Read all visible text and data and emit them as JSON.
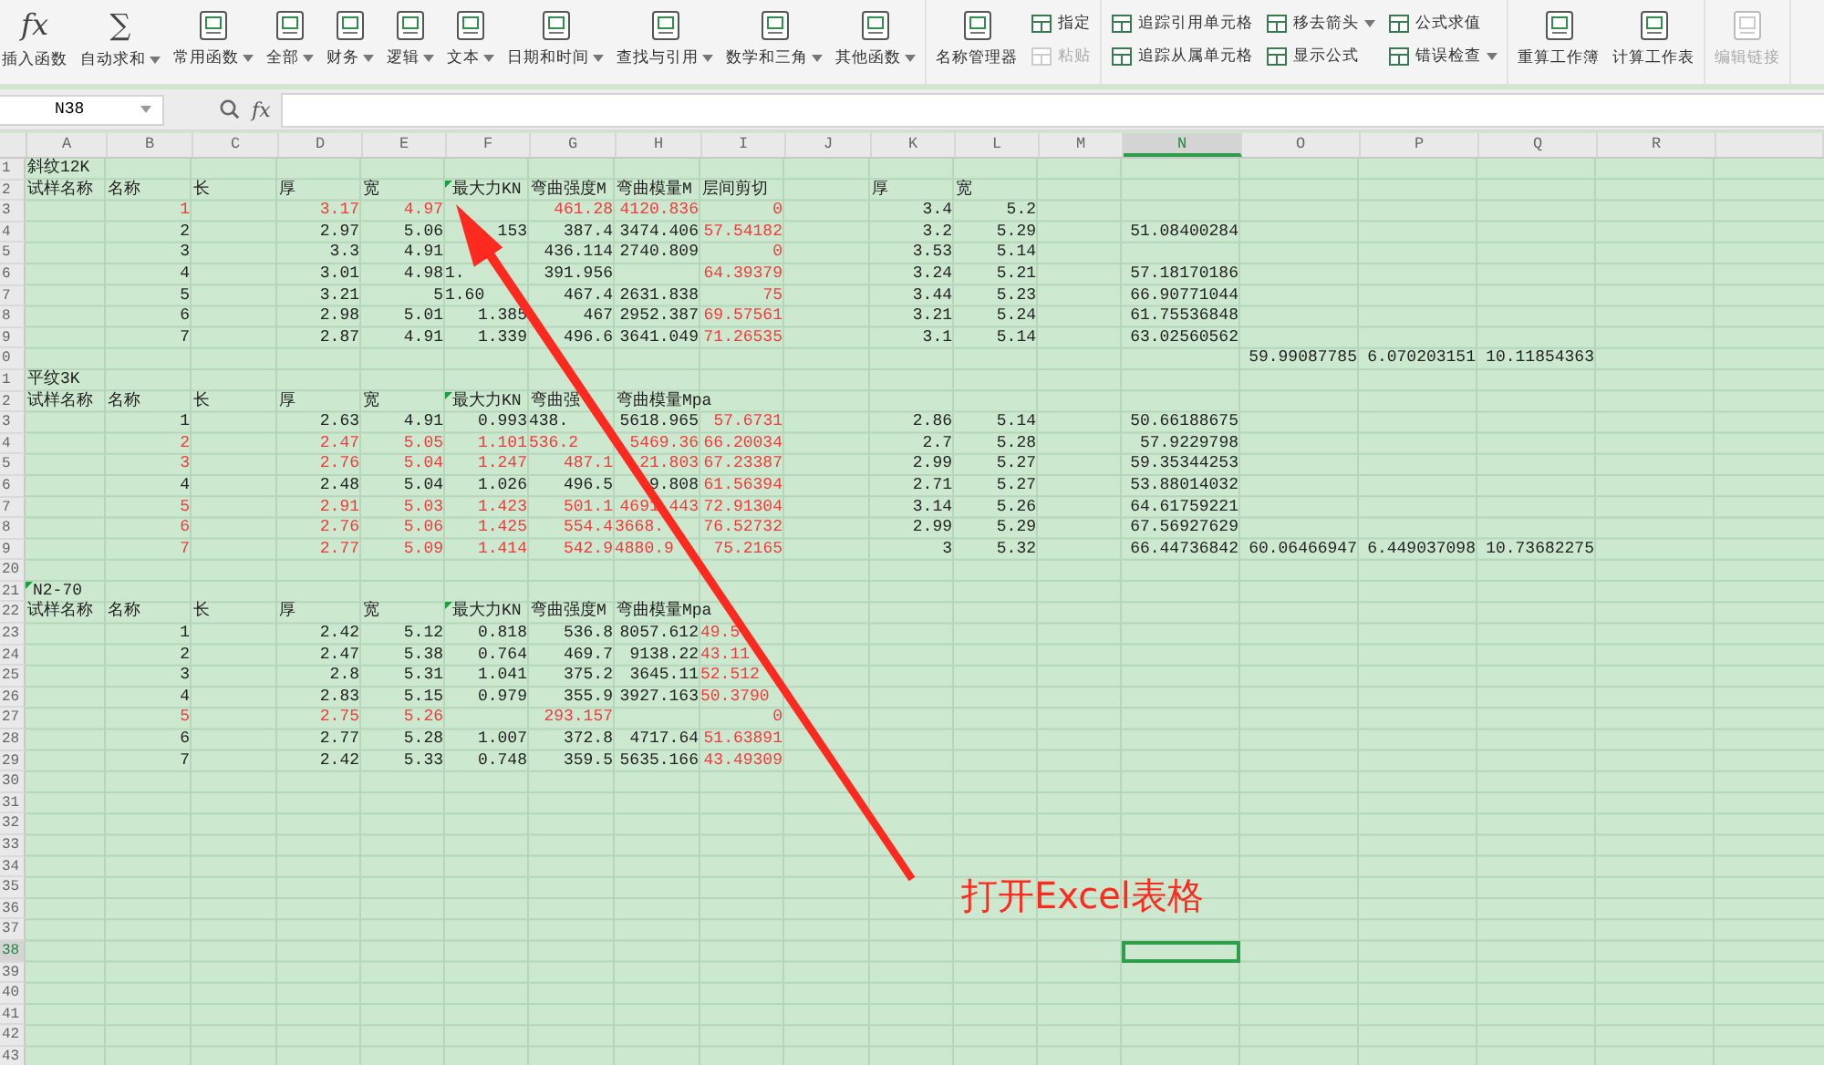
{
  "ribbon": [
    {
      "items": [
        {
          "kind": "large",
          "label": "插入函数",
          "glyph": "fx",
          "dropdown": false,
          "disabled": false
        },
        {
          "kind": "large",
          "label": "自动求和",
          "glyph": "∑",
          "dropdown": true,
          "disabled": false
        },
        {
          "kind": "large",
          "label": "常用函数",
          "dropdown": true,
          "disabled": false
        },
        {
          "kind": "large",
          "label": "全部",
          "dropdown": true,
          "disabled": false
        },
        {
          "kind": "large",
          "label": "财务",
          "dropdown": true,
          "disabled": false
        },
        {
          "kind": "large",
          "label": "逻辑",
          "dropdown": true,
          "disabled": false
        },
        {
          "kind": "large",
          "label": "文本",
          "dropdown": true,
          "disabled": false
        },
        {
          "kind": "large",
          "label": "日期和时间",
          "dropdown": true,
          "disabled": false
        },
        {
          "kind": "large",
          "label": "查找与引用",
          "dropdown": true,
          "disabled": false
        },
        {
          "kind": "large",
          "label": "数学和三角",
          "dropdown": true,
          "disabled": false
        },
        {
          "kind": "large",
          "label": "其他函数",
          "dropdown": true,
          "disabled": false
        }
      ]
    },
    {
      "items": [
        {
          "kind": "large",
          "label": "名称管理器",
          "dropdown": false,
          "disabled": false
        },
        {
          "kind": "stack",
          "items": [
            {
              "label": "指定",
              "dropdown": false,
              "disabled": false
            },
            {
              "label": "粘贴",
              "dropdown": false,
              "disabled": true
            }
          ]
        }
      ]
    },
    {
      "items": [
        {
          "kind": "stack",
          "items": [
            {
              "label": "追踪引用单元格",
              "dropdown": false,
              "disabled": false
            },
            {
              "label": "追踪从属单元格",
              "dropdown": false,
              "disabled": false
            }
          ]
        },
        {
          "kind": "stack",
          "items": [
            {
              "label": "移去箭头",
              "dropdown": true,
              "disabled": false
            },
            {
              "label": "显示公式",
              "dropdown": false,
              "disabled": false
            }
          ]
        },
        {
          "kind": "stack",
          "items": [
            {
              "label": "公式求值",
              "dropdown": false,
              "disabled": false
            },
            {
              "label": "错误检查",
              "dropdown": true,
              "disabled": false
            }
          ]
        }
      ]
    },
    {
      "items": [
        {
          "kind": "large",
          "label": "重算工作簿",
          "dropdown": false,
          "disabled": false
        },
        {
          "kind": "large",
          "label": "计算工作表",
          "dropdown": false,
          "disabled": false
        }
      ]
    },
    {
      "items": [
        {
          "kind": "large",
          "label": "编辑链接",
          "dropdown": false,
          "disabled": true
        }
      ]
    }
  ],
  "formula_bar": {
    "name_box": "N38",
    "glyph": "fx"
  },
  "columns": [
    {
      "label": "A",
      "selected": false
    },
    {
      "label": "B",
      "selected": false
    },
    {
      "label": "C",
      "selected": false
    },
    {
      "label": "D",
      "selected": false
    },
    {
      "label": "E",
      "selected": false
    },
    {
      "label": "F",
      "selected": false
    },
    {
      "label": "G",
      "selected": false
    },
    {
      "label": "H",
      "selected": false
    },
    {
      "label": "I",
      "selected": false
    },
    {
      "label": "J",
      "selected": false
    },
    {
      "label": "K",
      "selected": false
    },
    {
      "label": "L",
      "selected": false
    },
    {
      "label": "M",
      "selected": false
    },
    {
      "label": "N",
      "selected": true
    },
    {
      "label": "O",
      "selected": false
    },
    {
      "label": "P",
      "selected": false
    },
    {
      "label": "Q",
      "selected": false
    },
    {
      "label": "R",
      "selected": false
    }
  ],
  "rows": [
    {
      "num": "1",
      "selected": false,
      "cells": {
        "A": {
          "text": "斜纹12K",
          "kind": "text",
          "flagged": false,
          "note": false
        }
      }
    },
    {
      "num": "2",
      "selected": false,
      "cells": {
        "A": {
          "text": "试样名称",
          "kind": "text",
          "flagged": false,
          "note": false
        },
        "B": {
          "text": "名称",
          "kind": "text",
          "flagged": false,
          "note": false
        },
        "C": {
          "text": "长",
          "kind": "text",
          "flagged": false,
          "note": false
        },
        "D": {
          "text": "厚",
          "kind": "text",
          "flagged": false,
          "note": false
        },
        "E": {
          "text": "宽",
          "kind": "text",
          "flagged": false,
          "note": false
        },
        "F": {
          "text": "最大力KN",
          "kind": "text",
          "flagged": false,
          "note": true
        },
        "G": {
          "text": "弯曲强度M",
          "kind": "text",
          "flagged": false,
          "note": false
        },
        "H": {
          "text": "弯曲模量M",
          "kind": "text",
          "flagged": false,
          "note": false
        },
        "I": {
          "text": "层间剪切",
          "kind": "text",
          "flagged": false,
          "note": false
        },
        "K": {
          "text": "厚",
          "kind": "text",
          "flagged": false,
          "note": false
        },
        "L": {
          "text": "宽",
          "kind": "text",
          "flagged": false,
          "note": false
        }
      }
    },
    {
      "num": "3",
      "selected": false,
      "cells": {
        "B": {
          "text": "1",
          "kind": "number",
          "flagged": true,
          "note": false
        },
        "D": {
          "text": "3.17",
          "kind": "number",
          "flagged": true,
          "note": false
        },
        "E": {
          "text": "4.97",
          "kind": "number",
          "flagged": true,
          "note": false
        },
        "G": {
          "text": "461.28",
          "kind": "number",
          "flagged": true,
          "note": false
        },
        "H": {
          "text": "4120.836",
          "kind": "number",
          "flagged": true,
          "note": false
        },
        "I": {
          "text": "0",
          "kind": "number",
          "flagged": true,
          "note": false
        },
        "K": {
          "text": "3.4",
          "kind": "number",
          "flagged": false,
          "note": false
        },
        "L": {
          "text": "5.2",
          "kind": "number",
          "flagged": false,
          "note": false
        }
      }
    },
    {
      "num": "4",
      "selected": false,
      "cells": {
        "B": {
          "text": "2",
          "kind": "number",
          "flagged": false,
          "note": false
        },
        "D": {
          "text": "2.97",
          "kind": "number",
          "flagged": false,
          "note": false
        },
        "E": {
          "text": "5.06",
          "kind": "number",
          "flagged": false,
          "note": false
        },
        "F": {
          "text": "153",
          "kind": "number",
          "flagged": false,
          "note": false
        },
        "G": {
          "text": "387.4",
          "kind": "number",
          "flagged": false,
          "note": false
        },
        "H": {
          "text": "3474.406",
          "kind": "number",
          "flagged": false,
          "note": false
        },
        "I": {
          "text": "57.54182",
          "kind": "number",
          "flagged": true,
          "note": false
        },
        "K": {
          "text": "3.2",
          "kind": "number",
          "flagged": false,
          "note": false
        },
        "L": {
          "text": "5.29",
          "kind": "number",
          "flagged": false,
          "note": false
        },
        "N": {
          "text": "51.08400284",
          "kind": "number",
          "flagged": false,
          "note": false
        }
      }
    },
    {
      "num": "5",
      "selected": false,
      "cells": {
        "B": {
          "text": "3",
          "kind": "number",
          "flagged": false,
          "note": false
        },
        "D": {
          "text": "3.3",
          "kind": "number",
          "flagged": false,
          "note": false
        },
        "E": {
          "text": "4.91",
          "kind": "number",
          "flagged": false,
          "note": false
        },
        "G": {
          "text": "436.114",
          "kind": "number",
          "flagged": false,
          "note": false
        },
        "H": {
          "text": "2740.809",
          "kind": "number",
          "flagged": false,
          "note": false
        },
        "I": {
          "text": "0",
          "kind": "number",
          "flagged": true,
          "note": false
        },
        "K": {
          "text": "3.53",
          "kind": "number",
          "flagged": false,
          "note": false
        },
        "L": {
          "text": "5.14",
          "kind": "number",
          "flagged": false,
          "note": false
        }
      }
    },
    {
      "num": "6",
      "selected": false,
      "cells": {
        "B": {
          "text": "4",
          "kind": "number",
          "flagged": false,
          "note": false
        },
        "D": {
          "text": "3.01",
          "kind": "number",
          "flagged": false,
          "note": false
        },
        "E": {
          "text": "4.98",
          "kind": "number",
          "flagged": false,
          "note": false
        },
        "F": {
          "text": "1.",
          "kind": "partial",
          "flagged": false,
          "note": false
        },
        "G": {
          "text": "391.956",
          "kind": "number",
          "flagged": false,
          "note": false
        },
        "I": {
          "text": "64.39379",
          "kind": "number",
          "flagged": true,
          "note": false
        },
        "K": {
          "text": "3.24",
          "kind": "number",
          "flagged": false,
          "note": false
        },
        "L": {
          "text": "5.21",
          "kind": "number",
          "flagged": false,
          "note": false
        },
        "N": {
          "text": "57.18170186",
          "kind": "number",
          "flagged": false,
          "note": false
        }
      }
    },
    {
      "num": "7",
      "selected": false,
      "cells": {
        "B": {
          "text": "5",
          "kind": "number",
          "flagged": false,
          "note": false
        },
        "D": {
          "text": "3.21",
          "kind": "number",
          "flagged": false,
          "note": false
        },
        "E": {
          "text": "5",
          "kind": "number",
          "flagged": false,
          "note": false
        },
        "F": {
          "text": "1.60",
          "kind": "partial",
          "flagged": false,
          "note": false
        },
        "G": {
          "text": "467.4",
          "kind": "number",
          "flagged": false,
          "note": false
        },
        "H": {
          "text": "2631.838",
          "kind": "number",
          "flagged": false,
          "note": false
        },
        "I": {
          "text": "75",
          "kind": "number",
          "flagged": true,
          "note": false
        },
        "K": {
          "text": "3.44",
          "kind": "number",
          "flagged": false,
          "note": false
        },
        "L": {
          "text": "5.23",
          "kind": "number",
          "flagged": false,
          "note": false
        },
        "N": {
          "text": "66.90771044",
          "kind": "number",
          "flagged": false,
          "note": false
        }
      }
    },
    {
      "num": "8",
      "selected": false,
      "cells": {
        "B": {
          "text": "6",
          "kind": "number",
          "flagged": false,
          "note": false
        },
        "D": {
          "text": "2.98",
          "kind": "number",
          "flagged": false,
          "note": false
        },
        "E": {
          "text": "5.01",
          "kind": "number",
          "flagged": false,
          "note": false
        },
        "F": {
          "text": "1.385",
          "kind": "number",
          "flagged": false,
          "note": false
        },
        "G": {
          "text": "467",
          "kind": "number",
          "flagged": false,
          "note": false
        },
        "H": {
          "text": "2952.387",
          "kind": "number",
          "flagged": false,
          "note": false
        },
        "I": {
          "text": "69.57561",
          "kind": "number",
          "flagged": true,
          "note": false
        },
        "K": {
          "text": "3.21",
          "kind": "number",
          "flagged": false,
          "note": false
        },
        "L": {
          "text": "5.24",
          "kind": "number",
          "flagged": false,
          "note": false
        },
        "N": {
          "text": "61.75536848",
          "kind": "number",
          "flagged": false,
          "note": false
        }
      }
    },
    {
      "num": "9",
      "selected": false,
      "cells": {
        "B": {
          "text": "7",
          "kind": "number",
          "flagged": false,
          "note": false
        },
        "D": {
          "text": "2.87",
          "kind": "number",
          "flagged": false,
          "note": false
        },
        "E": {
          "text": "4.91",
          "kind": "number",
          "flagged": false,
          "note": false
        },
        "F": {
          "text": "1.339",
          "kind": "number",
          "flagged": false,
          "note": false
        },
        "G": {
          "text": "496.6",
          "kind": "number",
          "flagged": false,
          "note": false
        },
        "H": {
          "text": "3641.049",
          "kind": "number",
          "flagged": false,
          "note": false
        },
        "I": {
          "text": "71.26535",
          "kind": "number",
          "flagged": true,
          "note": false
        },
        "K": {
          "text": "3.1",
          "kind": "number",
          "flagged": false,
          "note": false
        },
        "L": {
          "text": "5.14",
          "kind": "number",
          "flagged": false,
          "note": false
        },
        "N": {
          "text": "63.02560562",
          "kind": "number",
          "flagged": false,
          "note": false
        }
      }
    },
    {
      "num": "0",
      "selected": false,
      "cells": {
        "O": {
          "text": "59.99087785",
          "kind": "number",
          "flagged": false,
          "note": false
        },
        "P": {
          "text": "6.070203151",
          "kind": "number",
          "flagged": false,
          "note": false
        },
        "Q": {
          "text": "10.11854363",
          "kind": "number",
          "flagged": false,
          "note": false
        }
      }
    },
    {
      "num": "1",
      "selected": false,
      "cells": {
        "A": {
          "text": "平纹3K",
          "kind": "text",
          "flagged": false,
          "note": false
        }
      }
    },
    {
      "num": "2",
      "selected": false,
      "cells": {
        "A": {
          "text": "试样名称",
          "kind": "text",
          "flagged": false,
          "note": false
        },
        "B": {
          "text": "名称",
          "kind": "text",
          "flagged": false,
          "note": false
        },
        "C": {
          "text": "长",
          "kind": "text",
          "flagged": false,
          "note": false
        },
        "D": {
          "text": "厚",
          "kind": "text",
          "flagged": false,
          "note": false
        },
        "E": {
          "text": "宽",
          "kind": "text",
          "flagged": false,
          "note": false
        },
        "F": {
          "text": "最大力KN",
          "kind": "text",
          "flagged": false,
          "note": true
        },
        "G": {
          "text": "弯曲强",
          "kind": "text",
          "flagged": false,
          "note": false
        },
        "H": {
          "text": "弯曲模量Mpa",
          "kind": "text",
          "flagged": false,
          "note": false
        }
      }
    },
    {
      "num": "3",
      "selected": false,
      "cells": {
        "B": {
          "text": "1",
          "kind": "number",
          "flagged": false,
          "note": false
        },
        "D": {
          "text": "2.63",
          "kind": "number",
          "flagged": false,
          "note": false
        },
        "E": {
          "text": "4.91",
          "kind": "number",
          "flagged": false,
          "note": false
        },
        "F": {
          "text": "0.993",
          "kind": "number",
          "flagged": false,
          "note": false
        },
        "G": {
          "text": "438.",
          "kind": "partial",
          "flagged": false,
          "note": false
        },
        "H": {
          "text": "5618.965",
          "kind": "number",
          "flagged": false,
          "note": false
        },
        "I": {
          "text": "57.6731",
          "kind": "number",
          "flagged": true,
          "note": false
        },
        "K": {
          "text": "2.86",
          "kind": "number",
          "flagged": false,
          "note": false
        },
        "L": {
          "text": "5.14",
          "kind": "number",
          "flagged": false,
          "note": false
        },
        "N": {
          "text": "50.66188675",
          "kind": "number",
          "flagged": false,
          "note": false
        }
      }
    },
    {
      "num": "4",
      "selected": false,
      "cells": {
        "B": {
          "text": "2",
          "kind": "number",
          "flagged": true,
          "note": false
        },
        "D": {
          "text": "2.47",
          "kind": "number",
          "flagged": true,
          "note": false
        },
        "E": {
          "text": "5.05",
          "kind": "number",
          "flagged": true,
          "note": false
        },
        "F": {
          "text": "1.101",
          "kind": "number",
          "flagged": true,
          "note": false
        },
        "G": {
          "text": "536.2",
          "kind": "partial",
          "flagged": true,
          "note": false
        },
        "H": {
          "text": "5469.36",
          "kind": "number",
          "flagged": true,
          "note": false
        },
        "I": {
          "text": "66.20034",
          "kind": "number",
          "flagged": true,
          "note": false
        },
        "K": {
          "text": "2.7",
          "kind": "number",
          "flagged": false,
          "note": false
        },
        "L": {
          "text": "5.28",
          "kind": "number",
          "flagged": false,
          "note": false
        },
        "N": {
          "text": "57.9229798",
          "kind": "number",
          "flagged": false,
          "note": false
        }
      }
    },
    {
      "num": "5",
      "selected": false,
      "cells": {
        "B": {
          "text": "3",
          "kind": "number",
          "flagged": true,
          "note": false
        },
        "D": {
          "text": "2.76",
          "kind": "number",
          "flagged": true,
          "note": false
        },
        "E": {
          "text": "5.04",
          "kind": "number",
          "flagged": true,
          "note": false
        },
        "F": {
          "text": "1.247",
          "kind": "number",
          "flagged": true,
          "note": false
        },
        "G": {
          "text": "487.1",
          "kind": "number",
          "flagged": true,
          "note": false
        },
        "H": {
          "text": "21.803",
          "kind": "number",
          "flagged": true,
          "note": false
        },
        "I": {
          "text": "67.23387",
          "kind": "number",
          "flagged": true,
          "note": false
        },
        "K": {
          "text": "2.99",
          "kind": "number",
          "flagged": false,
          "note": false
        },
        "L": {
          "text": "5.27",
          "kind": "number",
          "flagged": false,
          "note": false
        },
        "N": {
          "text": "59.35344253",
          "kind": "number",
          "flagged": false,
          "note": false
        }
      }
    },
    {
      "num": "6",
      "selected": false,
      "cells": {
        "B": {
          "text": "4",
          "kind": "number",
          "flagged": false,
          "note": false
        },
        "D": {
          "text": "2.48",
          "kind": "number",
          "flagged": false,
          "note": false
        },
        "E": {
          "text": "5.04",
          "kind": "number",
          "flagged": false,
          "note": false
        },
        "F": {
          "text": "1.026",
          "kind": "number",
          "flagged": false,
          "note": false
        },
        "G": {
          "text": "496.5",
          "kind": "number",
          "flagged": false,
          "note": false
        },
        "H": {
          "text": "9.808",
          "kind": "number",
          "flagged": false,
          "note": false
        },
        "I": {
          "text": "61.56394",
          "kind": "number",
          "flagged": true,
          "note": false
        },
        "K": {
          "text": "2.71",
          "kind": "number",
          "flagged": false,
          "note": false
        },
        "L": {
          "text": "5.27",
          "kind": "number",
          "flagged": false,
          "note": false
        },
        "N": {
          "text": "53.88014032",
          "kind": "number",
          "flagged": false,
          "note": false
        }
      }
    },
    {
      "num": "7",
      "selected": false,
      "cells": {
        "B": {
          "text": "5",
          "kind": "number",
          "flagged": true,
          "note": false
        },
        "D": {
          "text": "2.91",
          "kind": "number",
          "flagged": true,
          "note": false
        },
        "E": {
          "text": "5.03",
          "kind": "number",
          "flagged": true,
          "note": false
        },
        "F": {
          "text": "1.423",
          "kind": "number",
          "flagged": true,
          "note": false
        },
        "G": {
          "text": "501.1",
          "kind": "number",
          "flagged": true,
          "note": false
        },
        "H": {
          "text": "4691 443",
          "kind": "number",
          "flagged": true,
          "note": false
        },
        "I": {
          "text": "72.91304",
          "kind": "number",
          "flagged": true,
          "note": false
        },
        "K": {
          "text": "3.14",
          "kind": "number",
          "flagged": false,
          "note": false
        },
        "L": {
          "text": "5.26",
          "kind": "number",
          "flagged": false,
          "note": false
        },
        "N": {
          "text": "64.61759221",
          "kind": "number",
          "flagged": false,
          "note": false
        }
      }
    },
    {
      "num": "8",
      "selected": false,
      "cells": {
        "B": {
          "text": "6",
          "kind": "number",
          "flagged": true,
          "note": false
        },
        "D": {
          "text": "2.76",
          "kind": "number",
          "flagged": true,
          "note": false
        },
        "E": {
          "text": "5.06",
          "kind": "number",
          "flagged": true,
          "note": false
        },
        "F": {
          "text": "1.425",
          "kind": "number",
          "flagged": true,
          "note": false
        },
        "G": {
          "text": "554.4",
          "kind": "number",
          "flagged": true,
          "note": false
        },
        "H": {
          "text": "3668.",
          "kind": "partial",
          "flagged": true,
          "note": false
        },
        "I": {
          "text": "76.52732",
          "kind": "number",
          "flagged": true,
          "note": false
        },
        "K": {
          "text": "2.99",
          "kind": "number",
          "flagged": false,
          "note": false
        },
        "L": {
          "text": "5.29",
          "kind": "number",
          "flagged": false,
          "note": false
        },
        "N": {
          "text": "67.56927629",
          "kind": "number",
          "flagged": false,
          "note": false
        }
      }
    },
    {
      "num": "9",
      "selected": false,
      "cells": {
        "B": {
          "text": "7",
          "kind": "number",
          "flagged": true,
          "note": false
        },
        "D": {
          "text": "2.77",
          "kind": "number",
          "flagged": true,
          "note": false
        },
        "E": {
          "text": "5.09",
          "kind": "number",
          "flagged": true,
          "note": false
        },
        "F": {
          "text": "1.414",
          "kind": "number",
          "flagged": true,
          "note": false
        },
        "G": {
          "text": "542.9",
          "kind": "number",
          "flagged": true,
          "note": false
        },
        "H": {
          "text": "4880.9",
          "kind": "partial",
          "flagged": true,
          "note": false
        },
        "I": {
          "text": "75.2165",
          "kind": "number",
          "flagged": true,
          "note": false
        },
        "K": {
          "text": "3",
          "kind": "number",
          "flagged": false,
          "note": false
        },
        "L": {
          "text": "5.32",
          "kind": "number",
          "flagged": false,
          "note": false
        },
        "N": {
          "text": "66.44736842",
          "kind": "number",
          "flagged": false,
          "note": false
        },
        "O": {
          "text": "60.06466947",
          "kind": "number",
          "flagged": false,
          "note": false
        },
        "P": {
          "text": "6.449037098",
          "kind": "number",
          "flagged": false,
          "note": false
        },
        "Q": {
          "text": "10.73682275",
          "kind": "number",
          "flagged": false,
          "note": false
        }
      }
    },
    {
      "num": "20",
      "selected": false
    },
    {
      "num": "21",
      "selected": false,
      "cells": {
        "A": {
          "text": "N2-70",
          "kind": "text",
          "flagged": false,
          "note": true
        }
      }
    },
    {
      "num": "22",
      "selected": false,
      "cells": {
        "A": {
          "text": "试样名称",
          "kind": "text",
          "flagged": false,
          "note": false
        },
        "B": {
          "text": "名称",
          "kind": "text",
          "flagged": false,
          "note": false
        },
        "C": {
          "text": "长",
          "kind": "text",
          "flagged": false,
          "note": false
        },
        "D": {
          "text": "厚",
          "kind": "text",
          "flagged": false,
          "note": false
        },
        "E": {
          "text": "宽",
          "kind": "text",
          "flagged": false,
          "note": false
        },
        "F": {
          "text": "最大力KN",
          "kind": "text",
          "flagged": false,
          "note": true
        },
        "G": {
          "text": "弯曲强度M",
          "kind": "text",
          "flagged": false,
          "note": false
        },
        "H": {
          "text": "弯曲模量Mpa",
          "kind": "text",
          "flagged": false,
          "note": false
        }
      }
    },
    {
      "num": "23",
      "selected": false,
      "cells": {
        "B": {
          "text": "1",
          "kind": "number",
          "flagged": false,
          "note": false
        },
        "D": {
          "text": "2.42",
          "kind": "number",
          "flagged": false,
          "note": false
        },
        "E": {
          "text": "5.12",
          "kind": "number",
          "flagged": false,
          "note": false
        },
        "F": {
          "text": "0.818",
          "kind": "number",
          "flagged": false,
          "note": false
        },
        "G": {
          "text": "536.8",
          "kind": "number",
          "flagged": false,
          "note": false
        },
        "H": {
          "text": "8057.612",
          "kind": "number",
          "flagged": false,
          "note": false
        },
        "I": {
          "text": "49.5",
          "kind": "partial",
          "flagged": true,
          "note": false
        }
      }
    },
    {
      "num": "24",
      "selected": false,
      "cells": {
        "B": {
          "text": "2",
          "kind": "number",
          "flagged": false,
          "note": false
        },
        "D": {
          "text": "2.47",
          "kind": "number",
          "flagged": false,
          "note": false
        },
        "E": {
          "text": "5.38",
          "kind": "number",
          "flagged": false,
          "note": false
        },
        "F": {
          "text": "0.764",
          "kind": "number",
          "flagged": false,
          "note": false
        },
        "G": {
          "text": "469.7",
          "kind": "number",
          "flagged": false,
          "note": false
        },
        "H": {
          "text": "9138.22",
          "kind": "number",
          "flagged": false,
          "note": false
        },
        "I": {
          "text": "43.11",
          "kind": "partial",
          "flagged": true,
          "note": false
        }
      }
    },
    {
      "num": "25",
      "selected": false,
      "cells": {
        "B": {
          "text": "3",
          "kind": "number",
          "flagged": false,
          "note": false
        },
        "D": {
          "text": "2.8",
          "kind": "number",
          "flagged": false,
          "note": false
        },
        "E": {
          "text": "5.31",
          "kind": "number",
          "flagged": false,
          "note": false
        },
        "F": {
          "text": "1.041",
          "kind": "number",
          "flagged": false,
          "note": false
        },
        "G": {
          "text": "375.2",
          "kind": "number",
          "flagged": false,
          "note": false
        },
        "H": {
          "text": "3645.11",
          "kind": "number",
          "flagged": false,
          "note": false
        },
        "I": {
          "text": "52.512",
          "kind": "partial",
          "flagged": true,
          "note": false
        }
      }
    },
    {
      "num": "26",
      "selected": false,
      "cells": {
        "B": {
          "text": "4",
          "kind": "number",
          "flagged": false,
          "note": false
        },
        "D": {
          "text": "2.83",
          "kind": "number",
          "flagged": false,
          "note": false
        },
        "E": {
          "text": "5.15",
          "kind": "number",
          "flagged": false,
          "note": false
        },
        "F": {
          "text": "0.979",
          "kind": "number",
          "flagged": false,
          "note": false
        },
        "G": {
          "text": "355.9",
          "kind": "number",
          "flagged": false,
          "note": false
        },
        "H": {
          "text": "3927.163",
          "kind": "number",
          "flagged": false,
          "note": false
        },
        "I": {
          "text": "50.3790",
          "kind": "partial",
          "flagged": true,
          "note": false
        }
      }
    },
    {
      "num": "27",
      "selected": false,
      "cells": {
        "B": {
          "text": "5",
          "kind": "number",
          "flagged": true,
          "note": false
        },
        "D": {
          "text": "2.75",
          "kind": "number",
          "flagged": true,
          "note": false
        },
        "E": {
          "text": "5.26",
          "kind": "number",
          "flagged": true,
          "note": false
        },
        "G": {
          "text": "293.157",
          "kind": "number",
          "flagged": true,
          "note": false
        },
        "I": {
          "text": "0",
          "kind": "number",
          "flagged": true,
          "note": false
        }
      }
    },
    {
      "num": "28",
      "selected": false,
      "cells": {
        "B": {
          "text": "6",
          "kind": "number",
          "flagged": false,
          "note": false
        },
        "D": {
          "text": "2.77",
          "kind": "number",
          "flagged": false,
          "note": false
        },
        "E": {
          "text": "5.28",
          "kind": "number",
          "flagged": false,
          "note": false
        },
        "F": {
          "text": "1.007",
          "kind": "number",
          "flagged": false,
          "note": false
        },
        "G": {
          "text": "372.8",
          "kind": "number",
          "flagged": false,
          "note": false
        },
        "H": {
          "text": "4717.64",
          "kind": "number",
          "flagged": false,
          "note": false
        },
        "I": {
          "text": "51.63891",
          "kind": "number",
          "flagged": true,
          "note": false
        }
      }
    },
    {
      "num": "29",
      "selected": false,
      "cells": {
        "B": {
          "text": "7",
          "kind": "number",
          "flagged": false,
          "note": false
        },
        "D": {
          "text": "2.42",
          "kind": "number",
          "flagged": false,
          "note": false
        },
        "E": {
          "text": "5.33",
          "kind": "number",
          "flagged": false,
          "note": false
        },
        "F": {
          "text": "0.748",
          "kind": "number",
          "flagged": false,
          "note": false
        },
        "G": {
          "text": "359.5",
          "kind": "number",
          "flagged": false,
          "note": false
        },
        "H": {
          "text": "5635.166",
          "kind": "number",
          "flagged": false,
          "note": false
        },
        "I": {
          "text": "43.49309",
          "kind": "number",
          "flagged": true,
          "note": false
        }
      }
    },
    {
      "num": "30",
      "selected": false
    },
    {
      "num": "31",
      "selected": false
    },
    {
      "num": "32",
      "selected": false
    },
    {
      "num": "33",
      "selected": false
    },
    {
      "num": "34",
      "selected": false
    },
    {
      "num": "35",
      "selected": false
    },
    {
      "num": "36",
      "selected": false
    },
    {
      "num": "37",
      "selected": false
    },
    {
      "num": "38",
      "selected": true
    },
    {
      "num": "39",
      "selected": false
    },
    {
      "num": "40",
      "selected": false
    },
    {
      "num": "41",
      "selected": false
    },
    {
      "num": "42",
      "selected": false
    },
    {
      "num": "43",
      "selected": false
    }
  ],
  "annotation": {
    "label": "打开Excel表格"
  }
}
